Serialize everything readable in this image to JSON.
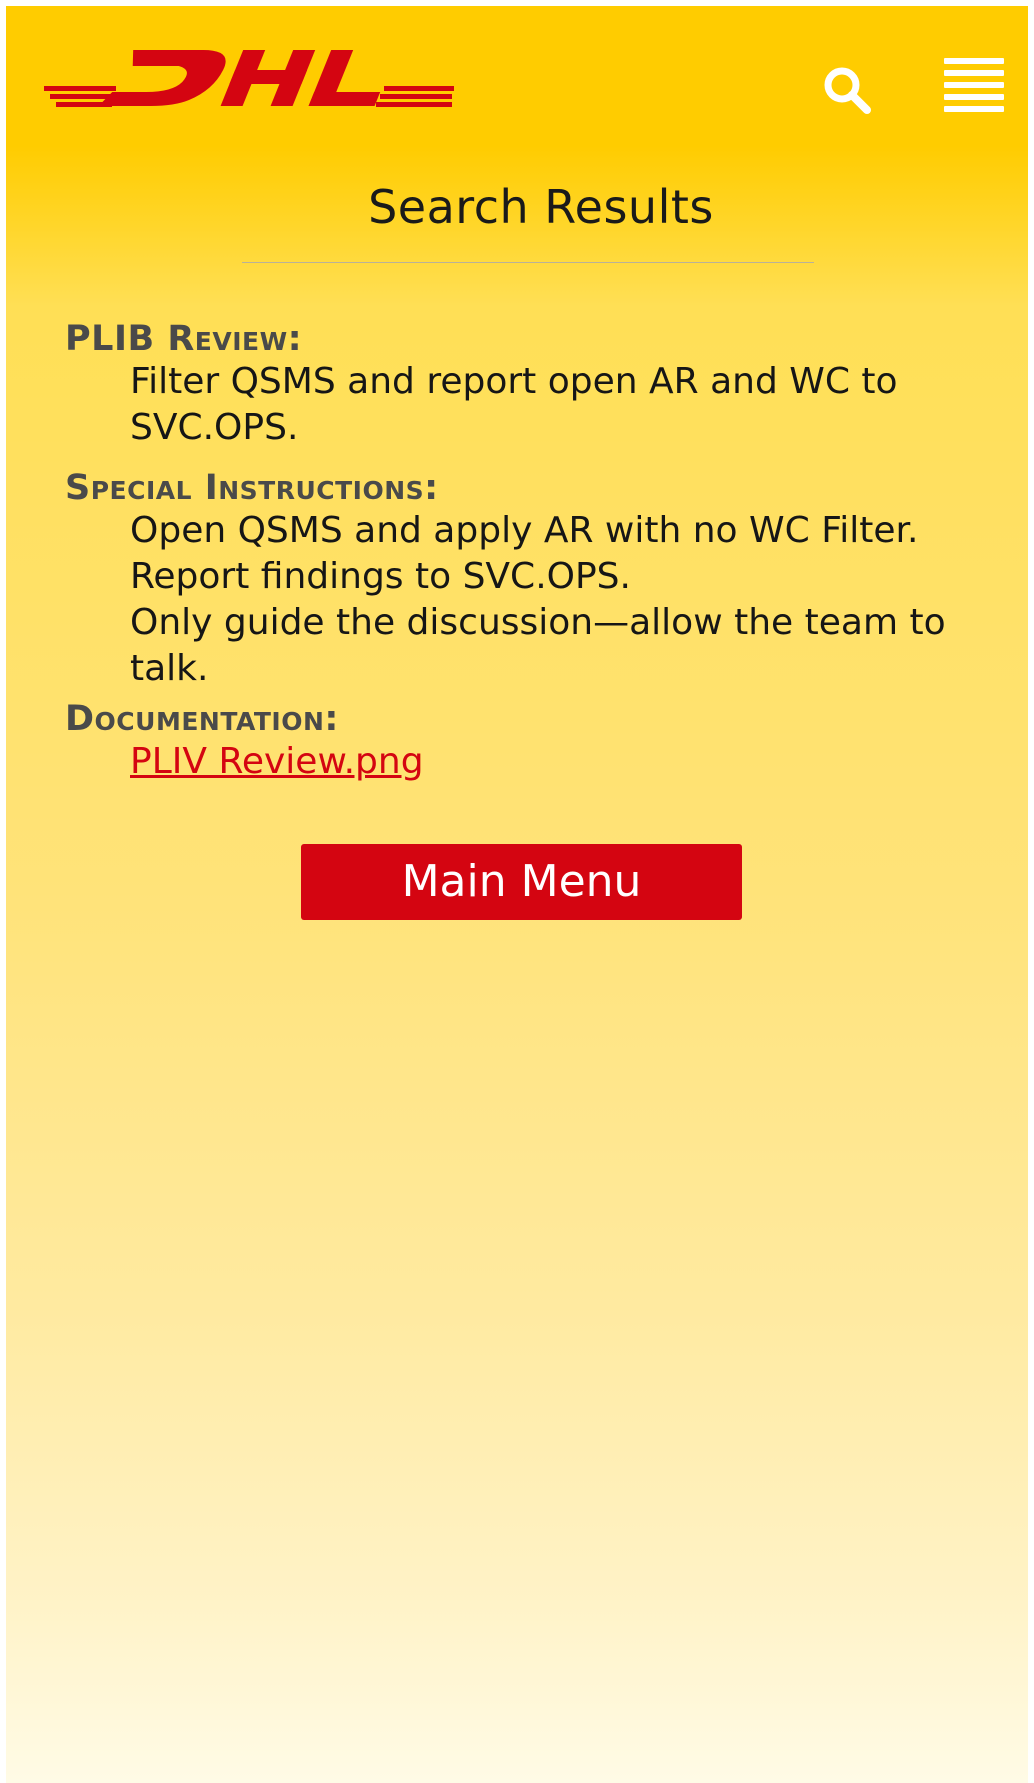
{
  "brand": {
    "name": "DHL",
    "color": "#d40511",
    "background": "#ffcc00"
  },
  "header": {
    "search_icon": "search-icon",
    "menu_icon": "hamburger-menu-icon"
  },
  "page": {
    "title": "Search Results"
  },
  "results": {
    "plib_review": {
      "label": "PLIB Review:",
      "lines": [
        "Filter QSMS and report open AR and WC to",
        "SVC.OPS."
      ]
    },
    "special_instructions": {
      "label": "Special Instructions:",
      "lines": [
        "Open QSMS and apply AR with no WC Filter.",
        "Report findings to SVC.OPS.",
        "Only guide the discussion—allow the team to",
        "talk."
      ]
    },
    "documentation": {
      "label": "Documentation:",
      "link": "PLIV Review.png"
    }
  },
  "actions": {
    "main_menu_label": "Main Menu"
  }
}
